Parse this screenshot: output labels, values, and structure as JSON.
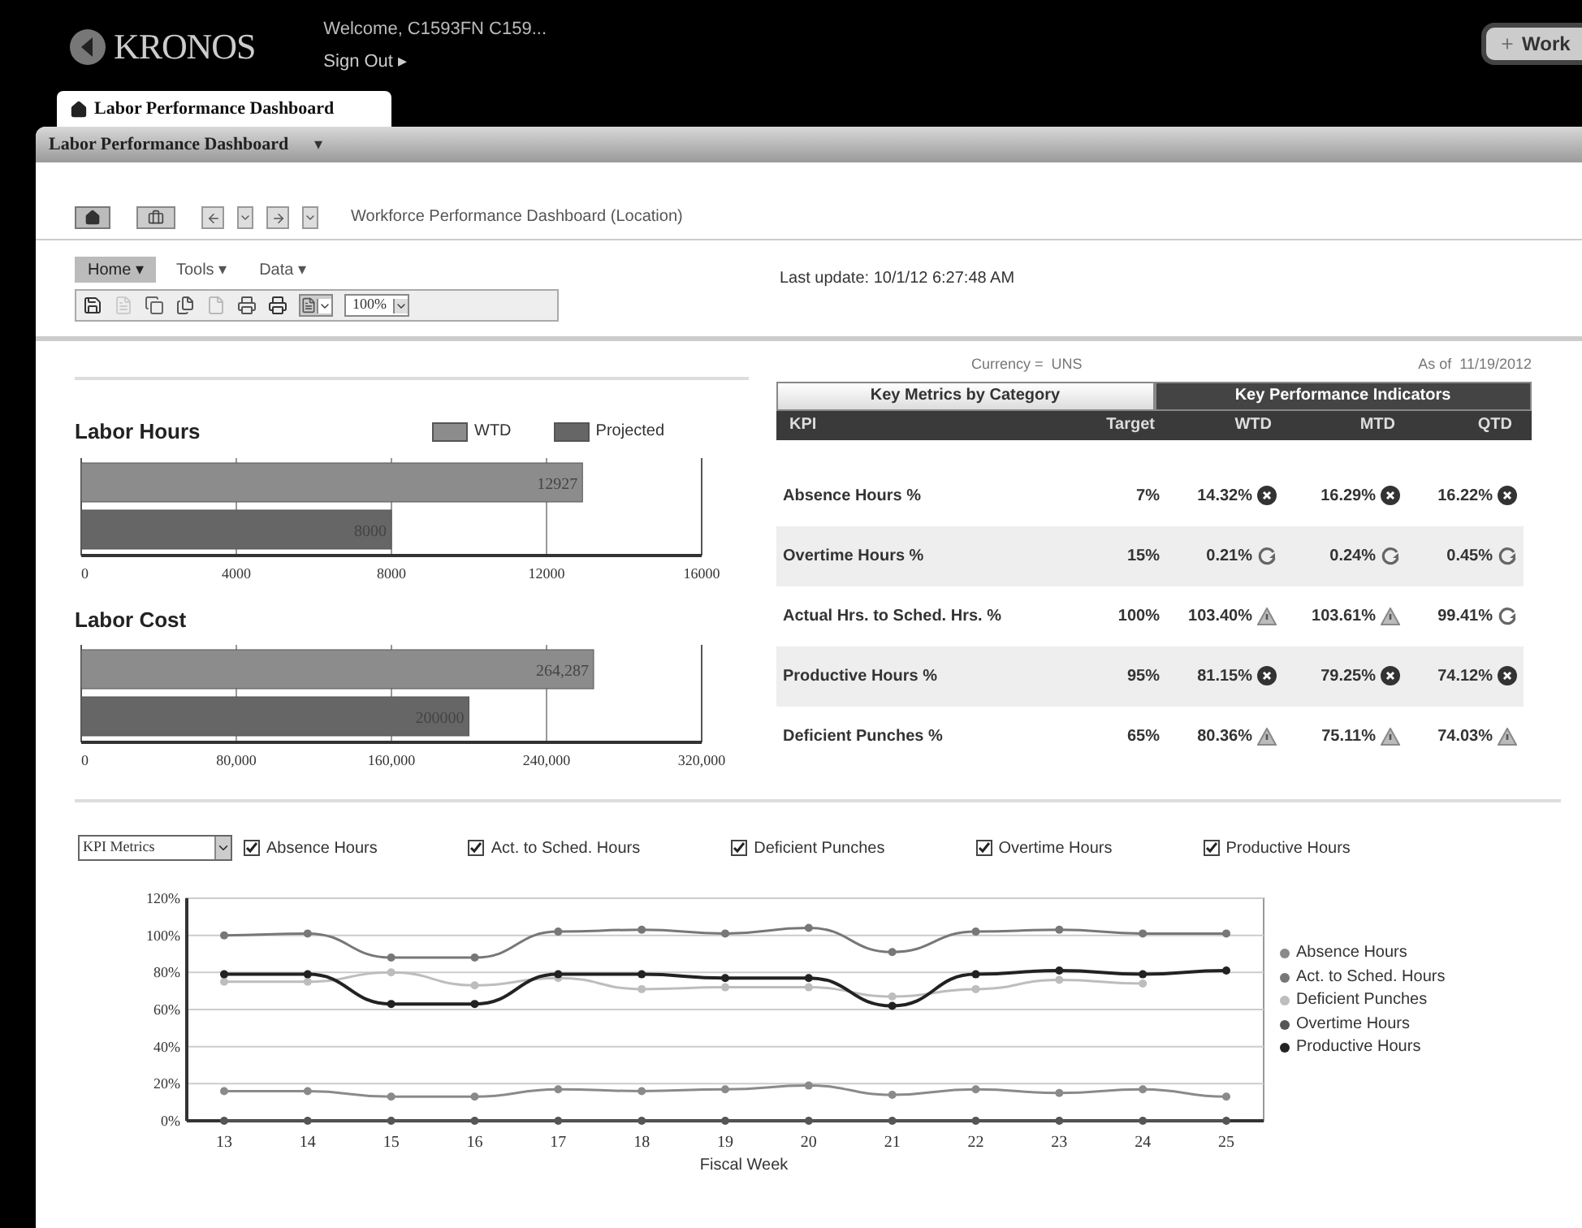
{
  "header": {
    "logo": "KRONOS",
    "welcome": "Welcome, C1593FN C159...",
    "sign_out": "Sign Out ▸",
    "side_tab": "Work"
  },
  "tab": {
    "label": "Labor Performance Dashboard",
    "selected": true
  },
  "title_bar": {
    "title": "Labor Performance Dashboard",
    "caret": "▾"
  },
  "breadcrumb": "Workforce Performance Dashboard (Location)",
  "menu": [
    {
      "label": "Home ▾",
      "selected": true
    },
    {
      "label": "Tools ▾",
      "selected": false
    },
    {
      "label": "Data ▾",
      "selected": false
    }
  ],
  "zoom": "100%",
  "last_update": "Last update: 10/1/12 6:27:48 AM",
  "labor_hours": {
    "title": "Labor Hours",
    "chart_data": {
      "type": "bar",
      "orientation": "horizontal",
      "series": [
        {
          "name": "WTD",
          "color": "#8c8c8c",
          "values": [
            12927
          ]
        },
        {
          "name": "Projected",
          "color": "#666666",
          "values": [
            8000
          ]
        }
      ],
      "value_labels": [
        "12927",
        "8000"
      ],
      "grid": true,
      "xlim": [
        0,
        16000
      ],
      "xticks": [
        0,
        4000,
        8000,
        12000,
        16000
      ]
    }
  },
  "labor_cost": {
    "title": "Labor Cost",
    "chart_data": {
      "type": "bar",
      "orientation": "horizontal",
      "series": [
        {
          "color": "#8c8c8c",
          "values": [
            264287
          ]
        },
        {
          "color": "#666666",
          "values": [
            200000
          ]
        }
      ],
      "value_labels": [
        "264,287",
        "200000"
      ],
      "grid": true,
      "xlim": [
        0,
        320000
      ],
      "xticks": [
        {
          "value": 0,
          "label": "0"
        },
        {
          "value": 80000,
          "label": "80,000"
        },
        {
          "value": 160000,
          "label": "160,000"
        },
        {
          "value": 240000,
          "label": "240,000"
        },
        {
          "value": 320000,
          "label": "320,000"
        }
      ]
    }
  },
  "kpi_panel": {
    "currency": "Currency =  UNS",
    "as_of": "As of  11/19/2012",
    "tabs": [
      {
        "label": "Key Metrics by Category",
        "selected": false
      },
      {
        "label": "Key Performance Indicators",
        "selected": true
      }
    ],
    "columns": [
      "KPI",
      "Target",
      "WTD",
      "MTD",
      "QTD"
    ],
    "rows": [
      {
        "kpi": "Absence Hours %",
        "target": "7%",
        "cells": [
          {
            "value": "14.32%",
            "kind": "bad"
          },
          {
            "value": "16.29%",
            "kind": "bad"
          },
          {
            "value": "16.22%",
            "kind": "bad"
          }
        ]
      },
      {
        "kpi": "Overtime Hours %",
        "target": "15%",
        "cells": [
          {
            "value": "0.21%",
            "kind": "ok"
          },
          {
            "value": "0.24%",
            "kind": "ok"
          },
          {
            "value": "0.45%",
            "kind": "ok"
          }
        ]
      },
      {
        "kpi": "Actual Hrs. to Sched. Hrs. %",
        "target": "100%",
        "cells": [
          {
            "value": "103.40%",
            "kind": "warning"
          },
          {
            "value": "103.61%",
            "kind": "warning"
          },
          {
            "value": "99.41%",
            "kind": "ok"
          }
        ]
      },
      {
        "kpi": "Productive Hours %",
        "target": "95%",
        "cells": [
          {
            "value": "81.15%",
            "kind": "bad"
          },
          {
            "value": "79.25%",
            "kind": "bad"
          },
          {
            "value": "74.12%",
            "kind": "bad"
          }
        ]
      },
      {
        "kpi": "Deficient Punches %",
        "target": "65%",
        "cells": [
          {
            "value": "80.36%",
            "kind": "warning"
          },
          {
            "value": "75.11%",
            "kind": "warning"
          },
          {
            "value": "74.03%",
            "kind": "warning"
          }
        ]
      }
    ]
  },
  "trend": {
    "metric_select": "KPI Metrics",
    "filters": [
      {
        "label": "Absence Hours",
        "checked": true
      },
      {
        "label": "Act. to Sched. Hours",
        "checked": true
      },
      {
        "label": "Deficient Punches",
        "checked": true
      },
      {
        "label": "Overtime Hours",
        "checked": true
      },
      {
        "label": "Productive Hours",
        "checked": true
      }
    ],
    "chart_data": {
      "type": "line",
      "xlabel": "Fiscal Week",
      "grid": true,
      "legend": true,
      "x": [
        13,
        14,
        15,
        16,
        17,
        18,
        19,
        20,
        21,
        22,
        23,
        24,
        25
      ],
      "ylim": [
        0,
        120
      ],
      "yticks": [
        {
          "value": 0,
          "label": "0%"
        },
        {
          "value": 20,
          "label": "20%"
        },
        {
          "value": 40,
          "label": "40%"
        },
        {
          "value": 60,
          "label": "60%"
        },
        {
          "value": 80,
          "label": "80%"
        },
        {
          "value": 100,
          "label": "100%"
        },
        {
          "value": 120,
          "label": "120%"
        }
      ],
      "series": [
        {
          "name": "Absence Hours",
          "color": "#8a8a8a",
          "marker": true,
          "values": [
            16,
            16,
            13,
            13,
            17,
            16,
            17,
            19,
            14,
            17,
            15,
            17,
            13
          ]
        },
        {
          "name": "Act. to Sched. Hours",
          "color": "#777777",
          "marker": true,
          "values": [
            100,
            101,
            88,
            88,
            102,
            103,
            101,
            104,
            91,
            102,
            103,
            101,
            101
          ]
        },
        {
          "name": "Deficient Punches",
          "color": "#bdbdbd",
          "marker": true,
          "values": [
            75,
            75,
            80,
            73,
            77,
            71,
            72,
            72,
            67,
            71,
            76,
            74,
            null
          ]
        },
        {
          "name": "Overtime Hours",
          "color": "#555555",
          "marker": true,
          "values": [
            0,
            0,
            0,
            0,
            0,
            0,
            0,
            0,
            0,
            0,
            0,
            0,
            0
          ]
        },
        {
          "name": "Productive Hours",
          "color": "#222222",
          "marker": true,
          "values": [
            79,
            79,
            63,
            63,
            79,
            79,
            77,
            77,
            62,
            79,
            81,
            79,
            81
          ]
        }
      ]
    }
  }
}
